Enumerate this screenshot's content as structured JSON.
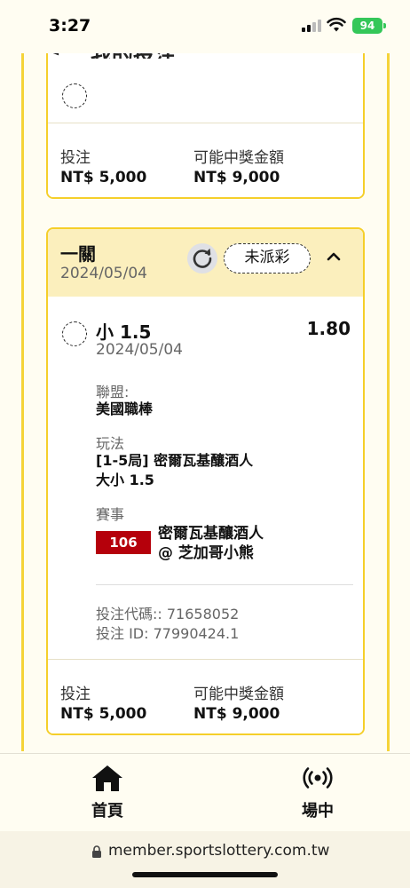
{
  "status_bar": {
    "time": "3:27",
    "battery": "94"
  },
  "header": {
    "title": "我的投注"
  },
  "cards": [
    {
      "stake_label": "投注",
      "stake_value": "NT$ 5,000",
      "payout_label": "可能中獎金額",
      "payout_value": "NT$ 9,000"
    },
    {
      "title": "一關",
      "date": "2024/05/04",
      "status": "未派彩",
      "selection": {
        "name": "小 1.5",
        "date": "2024/05/04",
        "odds": "1.80"
      },
      "league_label": "聯盟:",
      "league_value": "美國職棒",
      "play_label": "玩法",
      "play_value_line1": "[1-5局] 密爾瓦基釀酒人",
      "play_value_line2": "大小 1.5",
      "event_label": "賽事",
      "event_code": "106",
      "event_line1": "密爾瓦基釀酒人",
      "event_line2": "@ 芝加哥小熊",
      "bet_code": "投注代碼:: 71658052",
      "bet_id": "投注 ID: 77990424.1",
      "stake_label": "投注",
      "stake_value": "NT$ 5,000",
      "payout_label": "可能中獎金額",
      "payout_value": "NT$ 9,000"
    }
  ],
  "bottom_nav": [
    {
      "label": "首頁",
      "icon": "home-icon"
    },
    {
      "label": "場中",
      "icon": "live-broadcast-icon"
    }
  ],
  "browser": {
    "url": "member.sportslottery.com.tw"
  },
  "colors": {
    "accent": "#f5cf2a",
    "header_bg": "#fbefbd",
    "event_badge": "#b5000b",
    "battery": "#34c759"
  }
}
